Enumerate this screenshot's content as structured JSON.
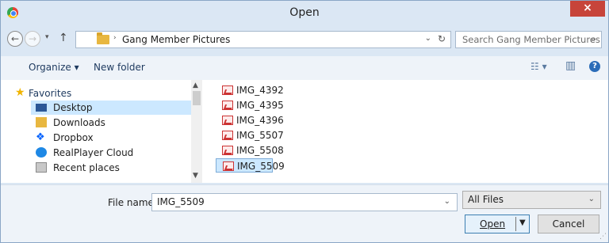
{
  "window": {
    "title": "Open",
    "close_label": "×"
  },
  "nav": {
    "back_glyph": "←",
    "forward_glyph": "→",
    "recent_glyph": "▾",
    "up_glyph": "↑",
    "path_separator": "›",
    "path": "Gang Member Pictures",
    "address_drop_glyph": "⌄",
    "refresh_glyph": "↻",
    "search_placeholder": "Search Gang Member Pictures",
    "search_glyph": "⌕"
  },
  "toolbar": {
    "organize_label": "Organize ▾",
    "new_folder_label": "New folder",
    "view_glyph": "☷ ▾",
    "preview_glyph": "▥",
    "help_glyph": "?"
  },
  "sidebar": {
    "favorites_label": "Favorites",
    "items": [
      {
        "label": "Desktop",
        "icon": "desktop-icon",
        "color": "#2b5797"
      },
      {
        "label": "Downloads",
        "icon": "downloads-icon",
        "color": "#e8b740"
      },
      {
        "label": "Dropbox",
        "icon": "dropbox-icon",
        "color": "#0061fe"
      },
      {
        "label": "RealPlayer Cloud",
        "icon": "realplayer-icon",
        "color": "#1e88e5"
      },
      {
        "label": "Recent places",
        "icon": "recent-places-icon",
        "color": "#8a8a8a"
      }
    ]
  },
  "files": [
    {
      "label": "IMG_4392"
    },
    {
      "label": "IMG_4395"
    },
    {
      "label": "IMG_4396"
    },
    {
      "label": "IMG_5507"
    },
    {
      "label": "IMG_5508"
    },
    {
      "label": "IMG_5509"
    }
  ],
  "bottom": {
    "file_name_label": "File name:",
    "file_name_value": "IMG_5509",
    "file_type_value": "All Files",
    "open_label": "Open",
    "cancel_label": "Cancel"
  }
}
